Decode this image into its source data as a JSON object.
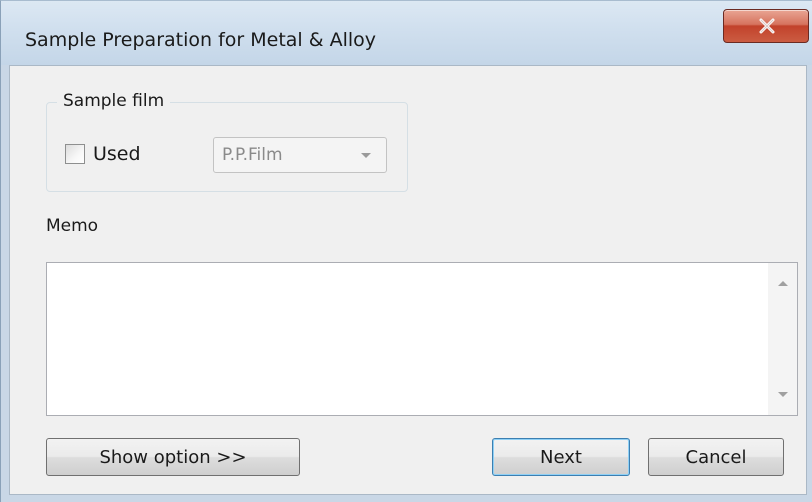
{
  "window": {
    "title": "Sample Preparation for Metal & Alloy",
    "close_icon": "close-x-icon"
  },
  "sample_film": {
    "legend": "Sample film",
    "used_label": "Used",
    "used_checked": false,
    "film_select_value": "P.P.Film",
    "film_select_enabled": false
  },
  "memo": {
    "label": "Memo",
    "value": ""
  },
  "buttons": {
    "show_option": "Show option >>",
    "next": "Next",
    "cancel": "Cancel"
  },
  "colors": {
    "close_button": "#c7432c",
    "default_button_border": "#3c7fb1",
    "dialog_background": "#f0f0f0"
  }
}
